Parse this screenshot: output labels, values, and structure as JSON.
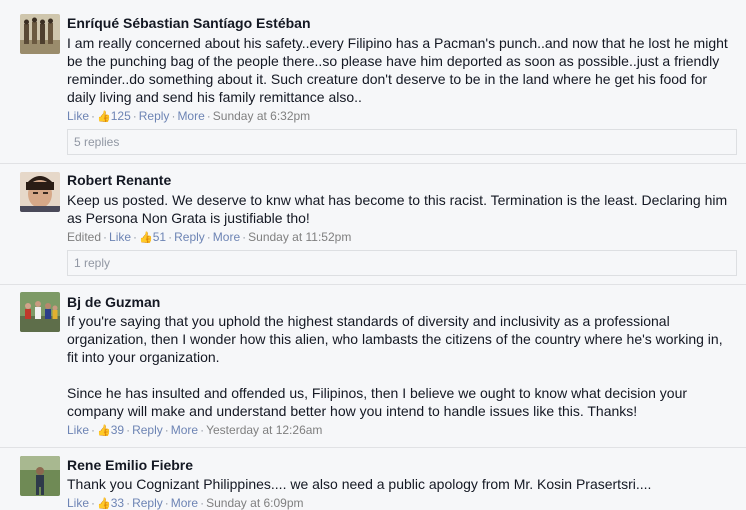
{
  "comments": [
    {
      "name": "Enríqué Sébastian Santíago Estéban",
      "body": [
        "I am really concerned about his safety..every Filipino has a Pacman's punch..and now that he lost he might be the punching bag of the people there..so please have him deported as soon as possible..just a friendly reminder..do something about it. Such creature don't deserve to be in the land where he get his food for daily living and send his family remittance also.."
      ],
      "edited": "",
      "like": "Like",
      "likes": "125",
      "reply": "Reply",
      "more": "More",
      "time": "Sunday at 6:32pm",
      "replies": "5 replies",
      "avatar_colors": [
        "#c9c0a8",
        "#7a6a4e"
      ]
    },
    {
      "name": "Robert Renante",
      "body": [
        "Keep us posted. We deserve to knw what has become to this racist. Termination is the least. Declaring him as Persona Non Grata is justifiable tho!"
      ],
      "edited": "Edited",
      "like": "Like",
      "likes": "51",
      "reply": "Reply",
      "more": "More",
      "time": "Sunday at 11:52pm",
      "replies": "1 reply",
      "avatar_colors": [
        "#d8b39a",
        "#3a2a20"
      ]
    },
    {
      "name": "Bj de Guzman",
      "body": [
        "If you're saying that you uphold the highest standards of diversity and inclusivity as a professional organization, then I wonder how this alien, who lambasts the citizens of the country where he's working in, fit into your organization.",
        "Since he has insulted and offended us, Filipinos, then I believe we ought to know what decision your company will make and understand better how you intend to handle issues like this. Thanks!"
      ],
      "edited": "",
      "like": "Like",
      "likes": "39",
      "reply": "Reply",
      "more": "More",
      "time": "Yesterday at 12:26am",
      "replies": "",
      "avatar_colors": [
        "#6b8a5a",
        "#b04a3a"
      ]
    },
    {
      "name": "Rene Emilio Fiebre",
      "body": [
        "Thank you Cognizant Philippines.... we also need a public apology from Mr. Kosin Prasertsri...."
      ],
      "edited": "",
      "like": "Like",
      "likes": "33",
      "reply": "Reply",
      "more": "More",
      "time": "Sunday at 6:09pm",
      "replies": "",
      "avatar_colors": [
        "#5c7a48",
        "#2e3a4a"
      ]
    }
  ],
  "colors": {
    "link": "#6d84b4",
    "meta": "#9197a3",
    "text": "#141823",
    "background": "#f6f7f9"
  }
}
